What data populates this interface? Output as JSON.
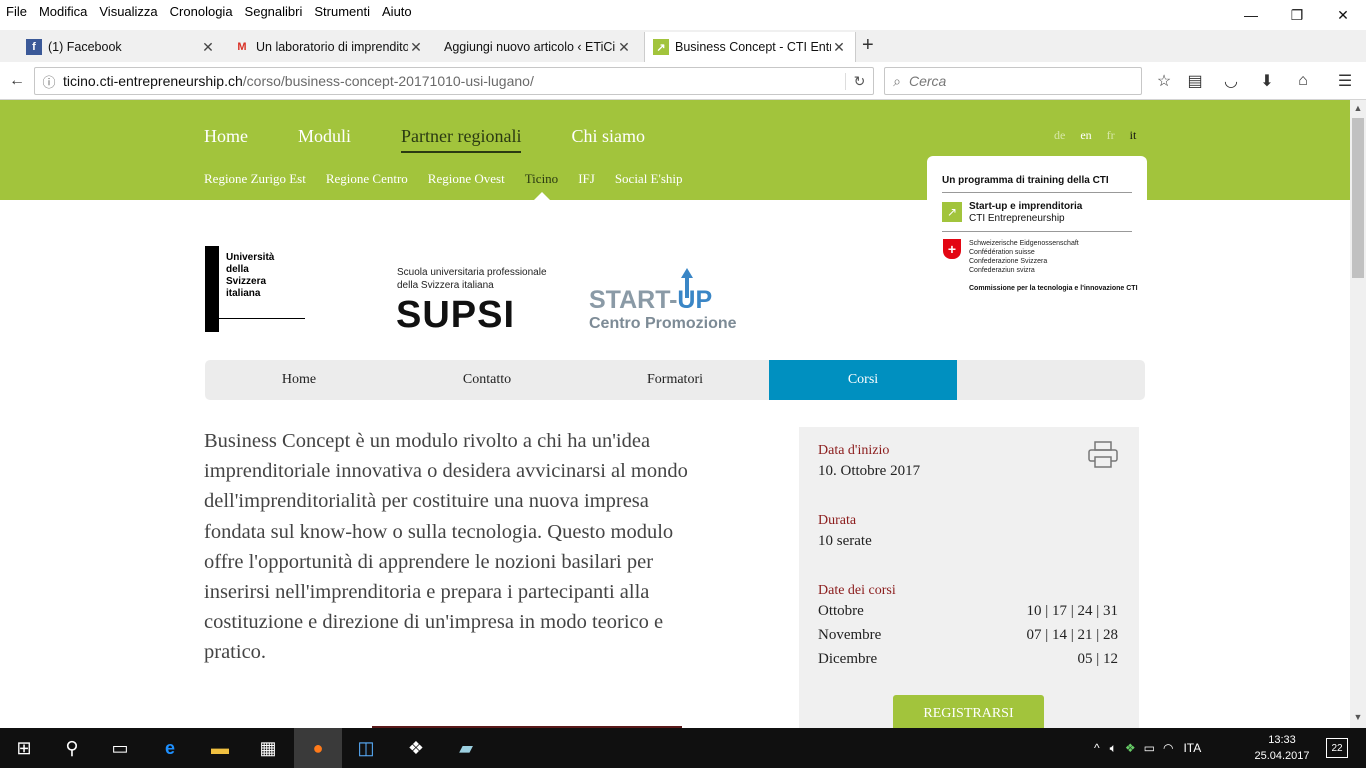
{
  "menu": [
    "File",
    "Modifica",
    "Visualizza",
    "Cronologia",
    "Segnalibri",
    "Strumenti",
    "Aiuto"
  ],
  "window_controls": {
    "minimize": "—",
    "restore": "❐",
    "close": "✕"
  },
  "tabs": [
    {
      "title": "(1) Facebook",
      "favicon": "f"
    },
    {
      "title": "Un laboratorio di imprendito",
      "favicon": "M"
    },
    {
      "title": "Aggiungi nuovo articolo ‹ ETiCin",
      "favicon": ""
    },
    {
      "title": "Business Concept - CTI Entre",
      "favicon": "↗"
    }
  ],
  "url": {
    "domain": "ticino.cti-entrepreneurship.ch",
    "path": "/corso/business-concept-20171010-usi-lugano/"
  },
  "search_placeholder": "Cerca",
  "site": {
    "top_nav": [
      "Home",
      "Moduli",
      "Partner regionali",
      "Chi siamo"
    ],
    "sub_nav": [
      "Regione Zurigo Est",
      "Regione Centro",
      "Regione Ovest",
      "Ticino",
      "IFJ",
      "Social E'ship"
    ],
    "languages": [
      "de",
      "en",
      "fr",
      "it"
    ],
    "cti_box": {
      "heading": "Un programma di training della CTI",
      "line1": "Start-up e imprenditoria",
      "line2": "CTI Entrepreneurship",
      "swiss": [
        "Schweizerische Eidgenossenschaft",
        "Confédération suisse",
        "Confederazione Svizzera",
        "Confederaziun svizra"
      ],
      "commission": "Commissione per la tecnologia e l'innovazione CTI"
    },
    "logos": {
      "usi": [
        "Università",
        "della",
        "Svizzera",
        "italiana"
      ],
      "supsi_sub": [
        "Scuola universitaria professionale",
        "della Svizzera italiana"
      ],
      "supsi": "SUPSI",
      "startup_a": "START-",
      "startup_b": "UP",
      "centro": "Centro Promozione"
    },
    "inner_nav": [
      "Home",
      "Contatto",
      "Formatori",
      "Corsi"
    ],
    "description": "Business Concept è un modulo rivolto a chi ha un'idea imprenditoriale innovativa o desidera avvicinarsi al mondo dell'imprenditorialità per costituire una nuova impresa fondata sul know-how o sulla tecnologia. Questo modulo offre l'opportunità di apprendere le nozioni basilari per inserirsi nell'imprenditoria e prepara i partecipanti alla costituzione e direzione di un'impresa in modo teorico e pratico.",
    "course": {
      "start_label": "Data d'inizio",
      "start_value": "10. Ottobre 2017",
      "duration_label": "Durata",
      "duration_value": "10 serate",
      "dates_label": "Date dei corsi",
      "dates": [
        {
          "month": "Ottobre",
          "days": "10 | 17 | 24 | 31"
        },
        {
          "month": "Novembre",
          "days": "07 | 14 | 21 | 28"
        },
        {
          "month": "Dicembre",
          "days": "05 | 12"
        }
      ],
      "register": "REGISTRARSI"
    }
  },
  "taskbar": {
    "lang": "ITA",
    "time": "13:33",
    "date": "25.04.2017",
    "notifications": "22"
  }
}
